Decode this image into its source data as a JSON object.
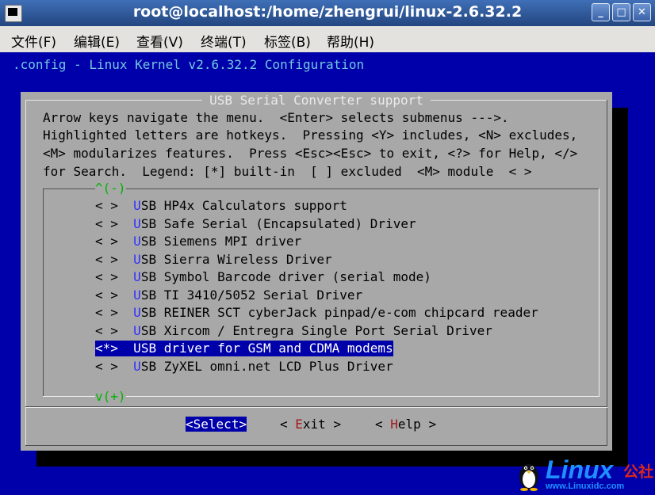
{
  "window": {
    "title": "root@localhost:/home/zhengrui/linux-2.6.32.2",
    "controls": {
      "minimize": "_",
      "maximize": "□",
      "close": "✕"
    }
  },
  "menubar": {
    "items": [
      "文件(F)",
      "编辑(E)",
      "查看(V)",
      "终端(T)",
      "标签(B)",
      "帮助(H)"
    ]
  },
  "terminal": {
    "config_title": ".config - Linux Kernel v2.6.32.2 Configuration"
  },
  "dialog": {
    "title": "USB Serial Converter support",
    "help_lines": [
      "Arrow keys navigate the menu.  <Enter> selects submenus --->.",
      "Highlighted letters are hotkeys.  Pressing <Y> includes, <N> excludes,",
      "<M> modularizes features.  Press <Esc><Esc> to exit, <?> for Help, </>",
      "for Search.  Legend: [*] built-in  [ ] excluded  <M> module  < >"
    ],
    "scroll_up": "^(-)",
    "scroll_down": "v(+)",
    "items": [
      {
        "state": "< >",
        "hotkey": "U",
        "label": "SB HP4x Calculators support",
        "selected": false
      },
      {
        "state": "< >",
        "hotkey": "U",
        "label": "SB Safe Serial (Encapsulated) Driver",
        "selected": false
      },
      {
        "state": "< >",
        "hotkey": "U",
        "label": "SB Siemens MPI driver",
        "selected": false
      },
      {
        "state": "< >",
        "hotkey": "U",
        "label": "SB Sierra Wireless Driver",
        "selected": false
      },
      {
        "state": "< >",
        "hotkey": "U",
        "label": "SB Symbol Barcode driver (serial mode)",
        "selected": false
      },
      {
        "state": "< >",
        "hotkey": "U",
        "label": "SB TI 3410/5052 Serial Driver",
        "selected": false
      },
      {
        "state": "< >",
        "hotkey": "U",
        "label": "SB REINER SCT cyberJack pinpad/e-com chipcard reader",
        "selected": false
      },
      {
        "state": "< >",
        "hotkey": "U",
        "label": "SB Xircom / Entregra Single Port Serial Driver",
        "selected": false
      },
      {
        "state": "<*>",
        "hotkey": "U",
        "label": "SB driver for GSM and CDMA modems",
        "selected": true
      },
      {
        "state": "< >",
        "hotkey": "U",
        "label": "SB ZyXEL omni.net LCD Plus Driver",
        "selected": false
      }
    ],
    "buttons": {
      "select": {
        "open": "<",
        "hotkey": "S",
        "rest": "elect",
        "close": ">"
      },
      "exit": {
        "open": "< ",
        "hotkey": "E",
        "rest": "xit",
        "close": " >"
      },
      "help": {
        "open": "< ",
        "hotkey": "H",
        "rest": "elp",
        "close": " >"
      }
    }
  },
  "watermark": {
    "brand": "Linux",
    "suffix": "公社",
    "url": "www.Linuxidc.com"
  },
  "colors": {
    "terminal_bg": "#0000aa",
    "dialog_bg": "#a8a8a8",
    "hotkey_blue": "#3030ff",
    "hotkey_red": "#a31919",
    "scroll_green": "#00b400"
  }
}
